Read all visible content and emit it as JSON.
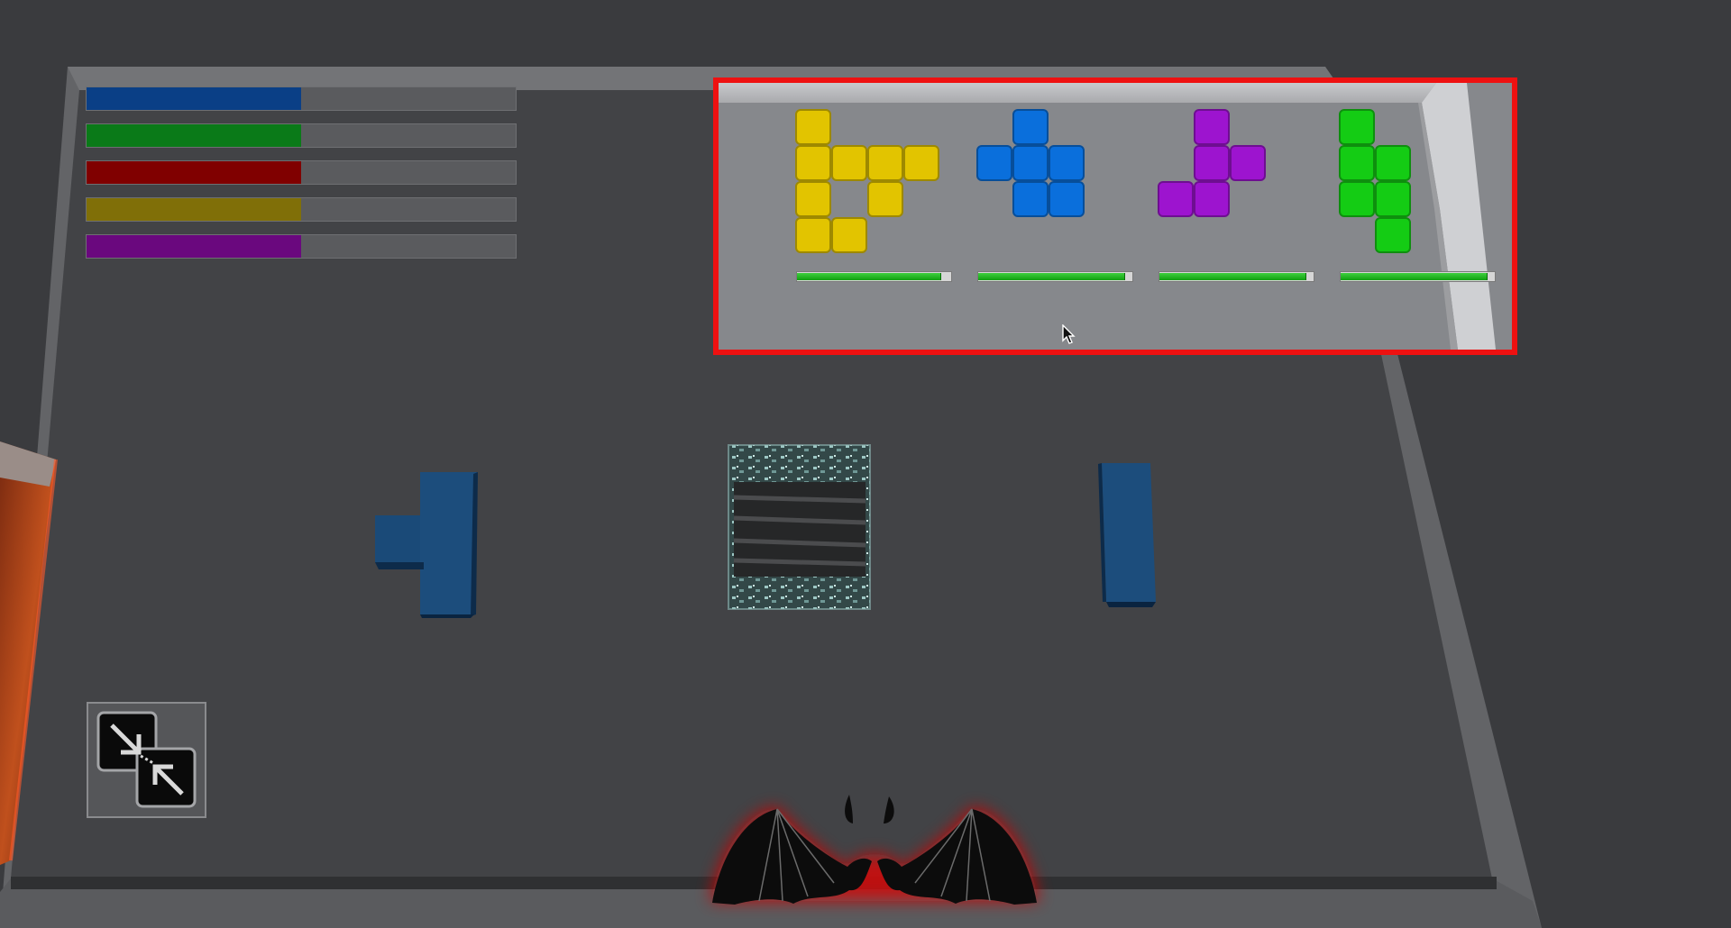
{
  "game": {
    "resource_bars": [
      {
        "name": "blue",
        "color": "#0a3f86",
        "level": 0.5
      },
      {
        "name": "green",
        "color": "#0a7a18",
        "level": 0.5
      },
      {
        "name": "red",
        "color": "#800000",
        "level": 0.5
      },
      {
        "name": "yellow",
        "color": "#806f08",
        "level": 0.5
      },
      {
        "name": "purple",
        "color": "#6a087e",
        "level": 0.5
      }
    ],
    "piece_tray": {
      "highlight_color": "#ee1111",
      "pieces": [
        {
          "name": "yellow-piece",
          "color": "#e2c400",
          "cells": [
            [
              0,
              0
            ],
            [
              0,
              1
            ],
            [
              1,
              1
            ],
            [
              2,
              1
            ],
            [
              3,
              1
            ],
            [
              0,
              2
            ],
            [
              2,
              2
            ],
            [
              0,
              3
            ],
            [
              1,
              3
            ]
          ],
          "timer": 0.93
        },
        {
          "name": "blue-piece",
          "color": "#0a6fdc",
          "cells": [
            [
              1,
              0
            ],
            [
              0,
              1
            ],
            [
              1,
              1
            ],
            [
              2,
              1
            ],
            [
              1,
              2
            ],
            [
              2,
              2
            ]
          ],
          "timer": 0.95
        },
        {
          "name": "purple-piece",
          "color": "#9d14cf",
          "cells": [
            [
              1,
              0
            ],
            [
              1,
              1
            ],
            [
              2,
              1
            ],
            [
              0,
              2
            ],
            [
              1,
              2
            ]
          ],
          "timer": 0.95
        },
        {
          "name": "green-piece",
          "color": "#14cc14",
          "cells": [
            [
              0,
              0
            ],
            [
              0,
              1
            ],
            [
              1,
              1
            ],
            [
              0,
              2
            ],
            [
              1,
              2
            ],
            [
              1,
              3
            ]
          ],
          "timer": 0.95
        }
      ]
    },
    "board_pieces": [
      {
        "name": "board-piece-t",
        "color": "#1a4a78"
      },
      {
        "name": "board-portal",
        "color": "#2b4f4f"
      },
      {
        "name": "board-piece-i",
        "color": "#1a4a78"
      }
    ],
    "tool_button": {
      "icon": "collapse-arrows-icon"
    },
    "emblem": {
      "icon": "bat-wings-emblem",
      "glow_color": "#cc1111"
    }
  }
}
